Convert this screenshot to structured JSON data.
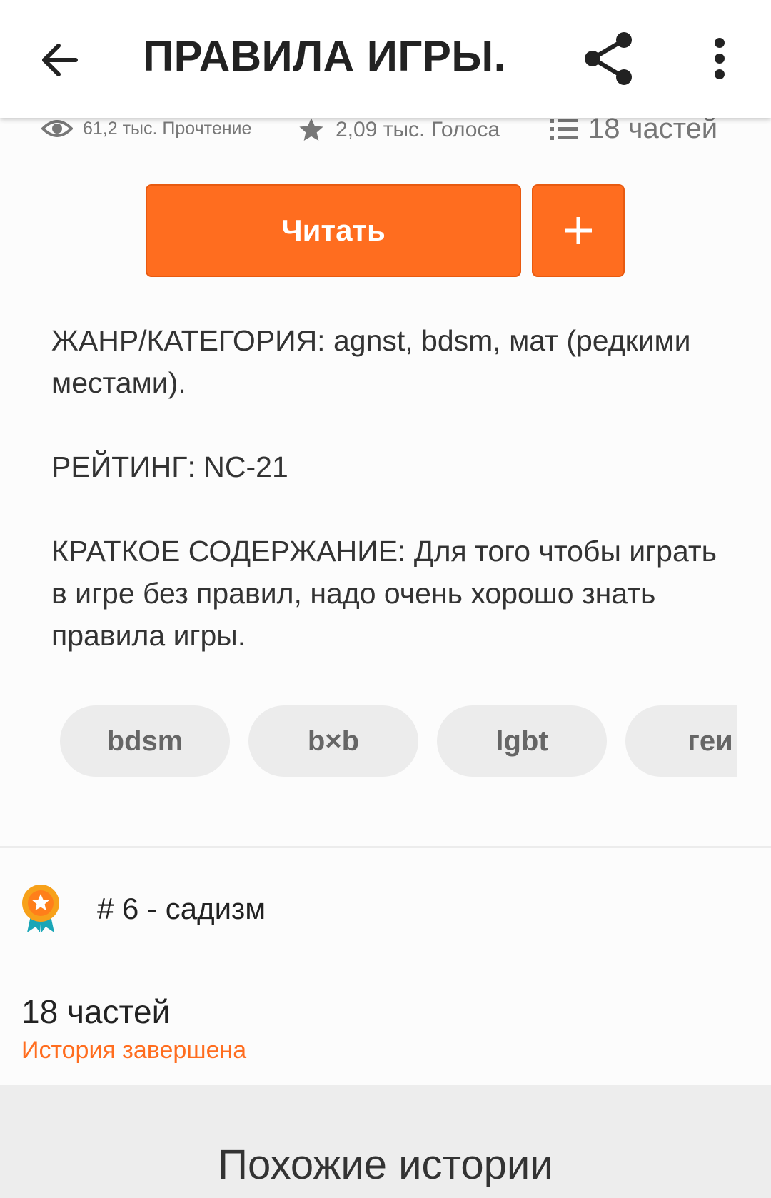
{
  "header": {
    "title": "ПРАВИЛА ИГРЫ.",
    "back_icon": "arrow-left-icon",
    "share_icon": "share-icon",
    "more_icon": "more-vert-icon"
  },
  "stats": {
    "reads": "61,2 тыс. Прочтение",
    "votes": "2,09 тыс. Голоса",
    "parts": "18 частей"
  },
  "actions": {
    "read_label": "Читать",
    "add_label": "+"
  },
  "description": {
    "genre": "ЖАНР/КАТЕГОРИЯ: agnst, bdsm, мат (редкими местами).",
    "rating": "РЕЙТИНГ: NC-21",
    "summary": "КРАТКОЕ СОДЕРЖАНИЕ: Для того чтобы играть в игре без правил, надо очень хорошо знать правила игры."
  },
  "tags": [
    "bdsm",
    "b×b",
    "lgbt",
    "геи"
  ],
  "ranking": {
    "text": "# 6 - садизм",
    "icon": "award-badge-icon"
  },
  "story_info": {
    "parts": "18 частей",
    "status": "История завершена"
  },
  "similar": {
    "heading": "Похожие истории"
  },
  "colors": {
    "accent": "#ff6d1f",
    "badge_orange": "#f7a11a",
    "badge_ribbon": "#1aa6b7"
  }
}
